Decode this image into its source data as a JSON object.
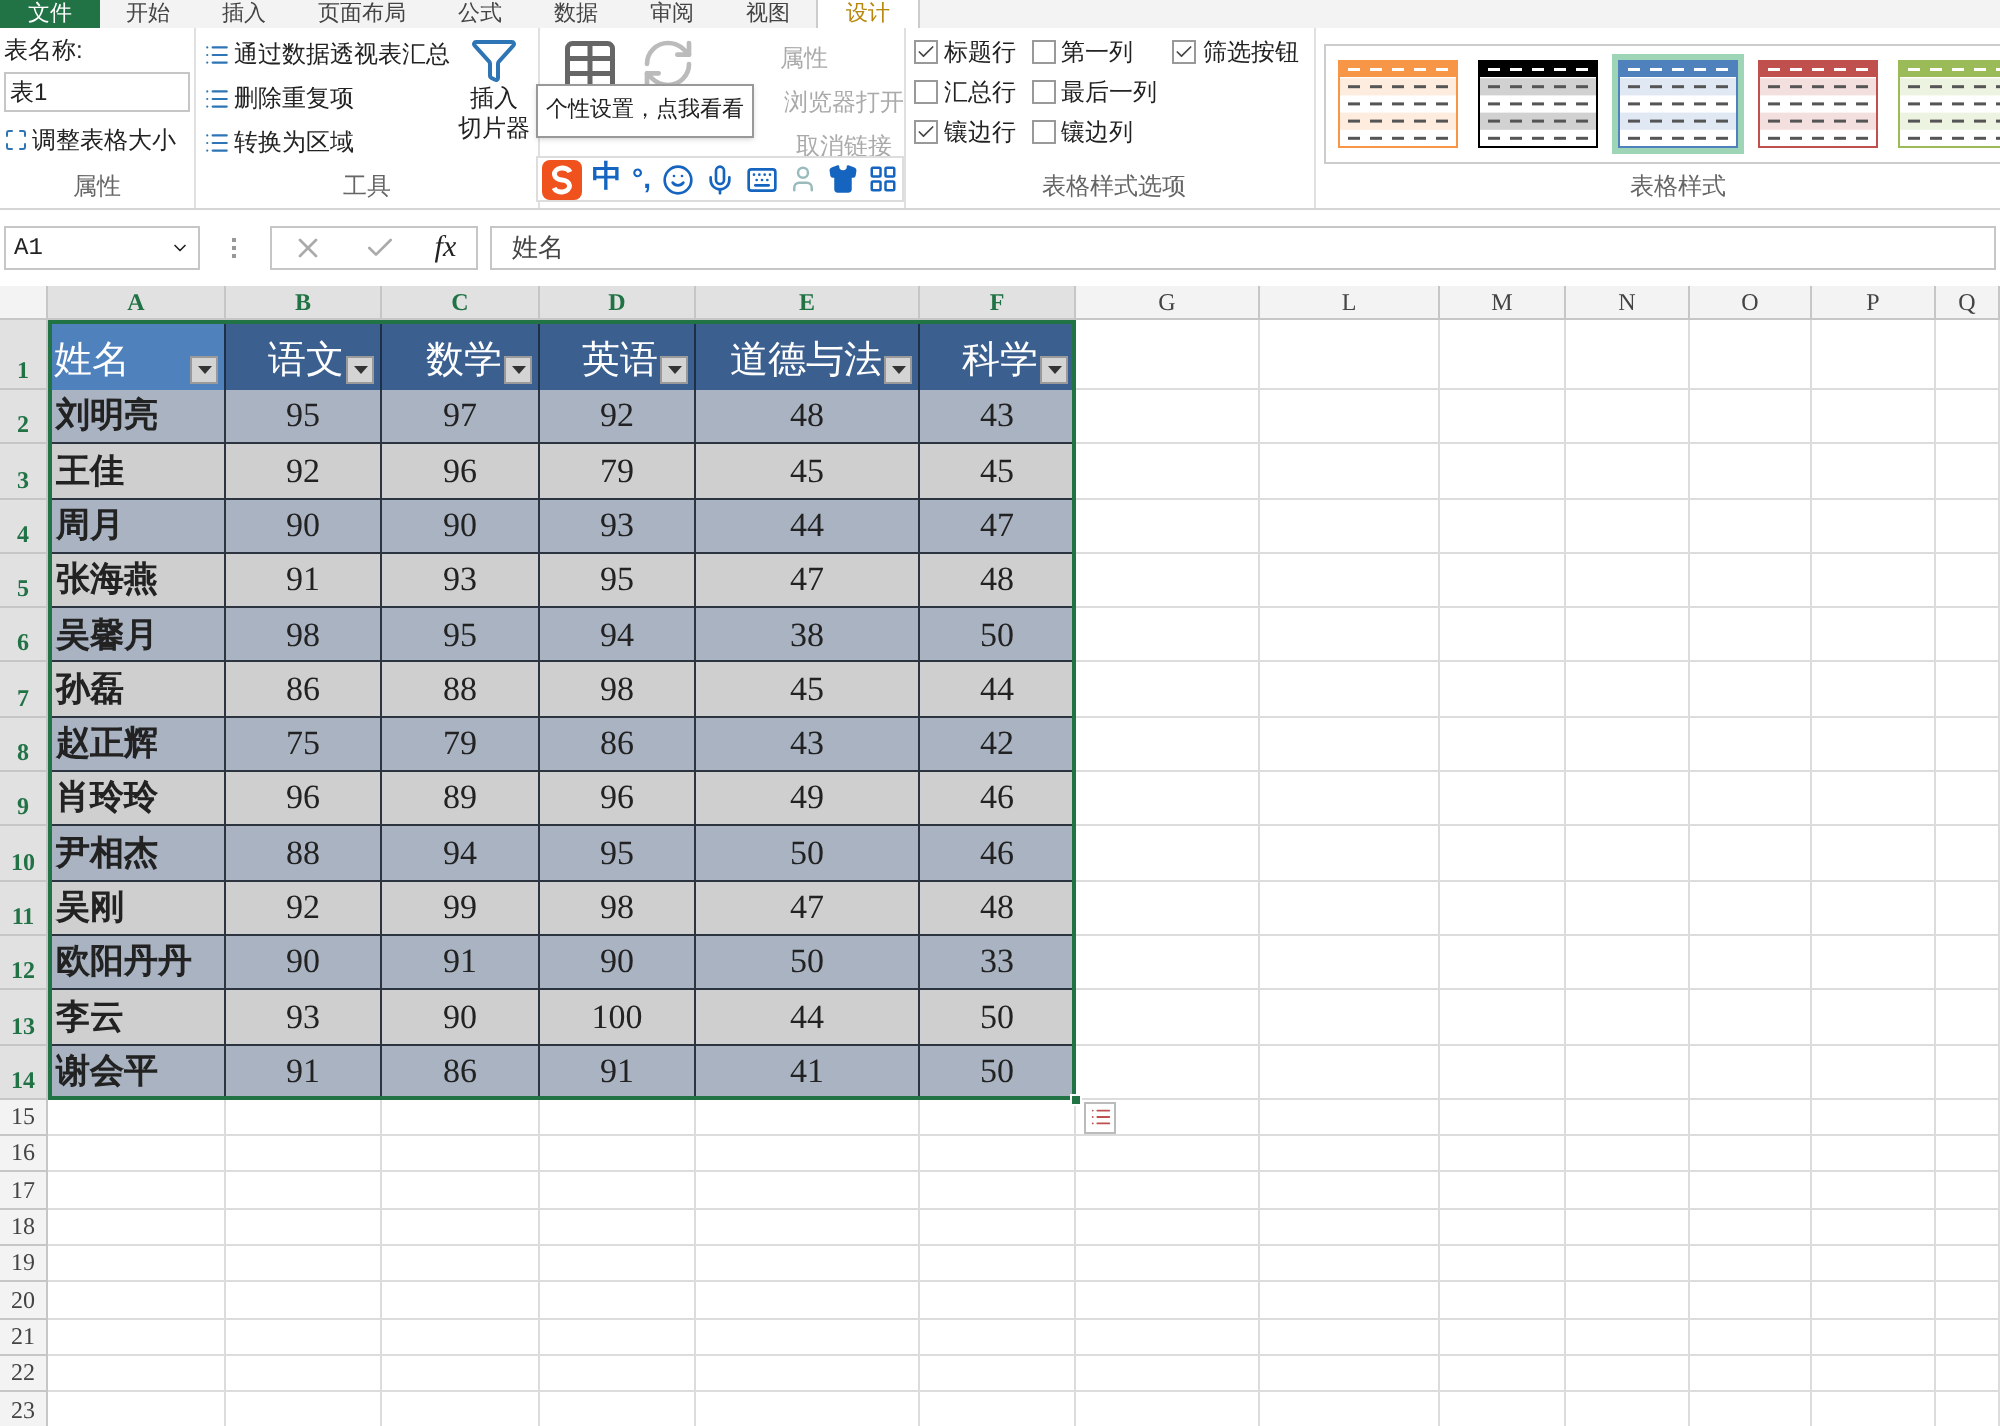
{
  "ribbon": {
    "tabs": [
      {
        "label": "文件",
        "kind": "file",
        "selected": false
      },
      {
        "label": "开始",
        "kind": "tab",
        "selected": false
      },
      {
        "label": "插入",
        "kind": "tab",
        "selected": false
      },
      {
        "label": "页面布局",
        "kind": "tab",
        "selected": false
      },
      {
        "label": "公式",
        "kind": "tab",
        "selected": false
      },
      {
        "label": "数据",
        "kind": "tab",
        "selected": false
      },
      {
        "label": "审阅",
        "kind": "tab",
        "selected": false
      },
      {
        "label": "视图",
        "kind": "tab",
        "selected": false
      },
      {
        "label": "设计",
        "kind": "tab",
        "selected": true
      }
    ],
    "properties": {
      "label": "属性",
      "name_label": "表名称:",
      "name_value": "表1",
      "resize_button": "调整表格大小"
    },
    "tools": {
      "label": "工具",
      "buttons": [
        "通过数据透视表汇总",
        "删除重复项",
        "转换为区域"
      ],
      "slicer_lines": [
        "插入",
        "切片器"
      ]
    },
    "external": {
      "buttons": [
        {
          "label": "属性",
          "disabled": true
        },
        {
          "label": "浏览器打开",
          "disabled": true
        },
        {
          "label": "取消链接",
          "disabled": true
        }
      ]
    },
    "style_options": {
      "label": "表格样式选项",
      "checkboxes": [
        {
          "label": "标题行",
          "checked": true
        },
        {
          "label": "汇总行",
          "checked": false
        },
        {
          "label": "镶边行",
          "checked": true
        },
        {
          "label": "第一列",
          "checked": false
        },
        {
          "label": "最后一列",
          "checked": false
        },
        {
          "label": "镶边列",
          "checked": false
        },
        {
          "label": "筛选按钮",
          "checked": true
        }
      ]
    },
    "styles": {
      "label": "表格样式",
      "swatches": [
        {
          "color": "#f79646",
          "selected": false
        },
        {
          "color": "#000000",
          "selected": false
        },
        {
          "color": "#4f81bd",
          "selected": true
        },
        {
          "color": "#c0504d",
          "selected": false
        },
        {
          "color": "#9bbb59",
          "selected": false
        }
      ]
    }
  },
  "tooltip": "个性设置，点我看看",
  "ime_bar": {
    "mode": "中",
    "punctuation": "°,"
  },
  "formula_bar": {
    "name_box": "A1",
    "function_label": "fx",
    "formula": "姓名"
  },
  "sheet": {
    "columns": [
      {
        "label": "A",
        "selected": true
      },
      {
        "label": "B",
        "selected": true
      },
      {
        "label": "C",
        "selected": true
      },
      {
        "label": "D",
        "selected": true
      },
      {
        "label": "E",
        "selected": true
      },
      {
        "label": "F",
        "selected": true
      },
      {
        "label": "G",
        "selected": false
      },
      {
        "label": "L",
        "selected": false
      },
      {
        "label": "M",
        "selected": false
      },
      {
        "label": "N",
        "selected": false
      },
      {
        "label": "O",
        "selected": false
      },
      {
        "label": "P",
        "selected": false
      },
      {
        "label": "Q",
        "selected": false
      }
    ],
    "rows": [
      {
        "label": "1",
        "selected": true
      },
      {
        "label": "2",
        "selected": true
      },
      {
        "label": "3",
        "selected": true
      },
      {
        "label": "4",
        "selected": true
      },
      {
        "label": "5",
        "selected": true
      },
      {
        "label": "6",
        "selected": true
      },
      {
        "label": "7",
        "selected": true
      },
      {
        "label": "8",
        "selected": true
      },
      {
        "label": "9",
        "selected": true
      },
      {
        "label": "10",
        "selected": true
      },
      {
        "label": "11",
        "selected": true
      },
      {
        "label": "12",
        "selected": true
      },
      {
        "label": "13",
        "selected": true
      },
      {
        "label": "14",
        "selected": true
      },
      {
        "label": "15",
        "selected": false
      },
      {
        "label": "16",
        "selected": false
      },
      {
        "label": "17",
        "selected": false
      },
      {
        "label": "18",
        "selected": false
      },
      {
        "label": "19",
        "selected": false
      },
      {
        "label": "20",
        "selected": false
      },
      {
        "label": "21",
        "selected": false
      },
      {
        "label": "22",
        "selected": false
      },
      {
        "label": "23",
        "selected": false
      }
    ],
    "table": {
      "headers": [
        {
          "label": "姓名",
          "selected": true
        },
        {
          "label": "语文",
          "selected": false
        },
        {
          "label": "数学",
          "selected": false
        },
        {
          "label": "英语",
          "selected": false
        },
        {
          "label": "道德与法",
          "selected": false
        },
        {
          "label": "科学",
          "selected": false
        }
      ],
      "rows": [
        [
          "刘明亮",
          "95",
          "97",
          "92",
          "48",
          "43"
        ],
        [
          "王佳",
          "92",
          "96",
          "79",
          "45",
          "45"
        ],
        [
          "周月",
          "90",
          "90",
          "93",
          "44",
          "47"
        ],
        [
          "张海燕",
          "91",
          "93",
          "95",
          "47",
          "48"
        ],
        [
          "吴馨月",
          "98",
          "95",
          "94",
          "38",
          "50"
        ],
        [
          "孙磊",
          "86",
          "88",
          "98",
          "45",
          "44"
        ],
        [
          "赵正辉",
          "75",
          "79",
          "86",
          "43",
          "42"
        ],
        [
          "肖玲玲",
          "96",
          "89",
          "96",
          "49",
          "46"
        ],
        [
          "尹相杰",
          "88",
          "94",
          "95",
          "50",
          "46"
        ],
        [
          "吴刚",
          "92",
          "99",
          "98",
          "47",
          "48"
        ],
        [
          "欧阳丹丹",
          "90",
          "91",
          "90",
          "50",
          "33"
        ],
        [
          "李云",
          "93",
          "90",
          "100",
          "44",
          "50"
        ],
        [
          "谢会平",
          "91",
          "86",
          "91",
          "41",
          "50"
        ]
      ]
    }
  }
}
